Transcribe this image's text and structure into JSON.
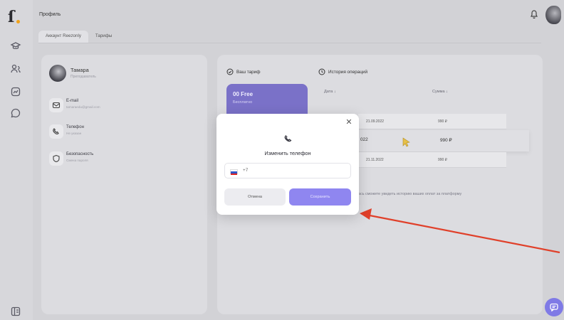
{
  "app": {
    "page_title": "Профиль"
  },
  "tabs": [
    {
      "label": "Аккаунт Reezonly"
    },
    {
      "label": "Тарифы"
    }
  ],
  "profile": {
    "name": "Тамара",
    "role": "Преподаватель",
    "email_label": "E-mail",
    "email_value": "tamaraedu@gmail.com",
    "phone_label": "Телефон",
    "phone_value": "Не указан",
    "security_label": "Безопасность",
    "security_value": "Смена пароля"
  },
  "plan": {
    "heading": "Ваш тариф",
    "name": "00 Free",
    "price": "Бесплатно"
  },
  "history": {
    "heading": "История операций",
    "col_date": "Дата ↓",
    "col_sum": "Сумма ↓",
    "rows": [
      {
        "date": "21.09.2022",
        "sum": "990 ₽"
      },
      {
        "date": "022",
        "sum": "990 ₽"
      },
      {
        "date": "21.11.2022",
        "sum": "990 ₽"
      }
    ],
    "empty_text": "ась сможете увидеть историю ваших оплат за платформу"
  },
  "modal": {
    "title": "Изменить телефон",
    "phone_prefix": "+7",
    "cancel_label": "Отмена",
    "save_label": "Сохранить"
  },
  "colors": {
    "accent": "#8f86f0",
    "plan_card": "#7a71c8",
    "annotation_arrow": "#e0402a"
  }
}
